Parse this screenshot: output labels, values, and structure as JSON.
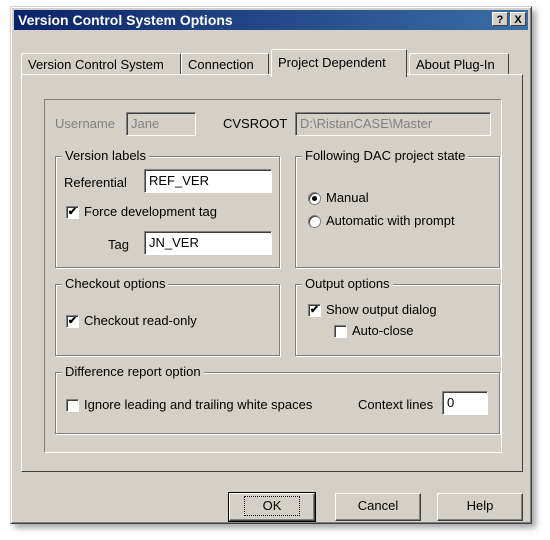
{
  "window": {
    "title": "Version Control System Options",
    "help_glyph": "?",
    "close_glyph": "X"
  },
  "tabs": [
    {
      "label": "Version Control System"
    },
    {
      "label": "Connection"
    },
    {
      "label": "Project Dependent",
      "active": true
    },
    {
      "label": "About Plug-In"
    }
  ],
  "identity": {
    "username_label": "Username",
    "username_value": "Jane",
    "cvsroot_label": "CVSROOT",
    "cvsroot_value": "D:\\RistanCASE\\Master"
  },
  "version_labels": {
    "legend": "Version labels",
    "referential_label": "Referential",
    "referential_value": "REF_VER",
    "force_dev_tag_label": "Force development tag",
    "force_dev_tag_checked": true,
    "tag_label": "Tag",
    "tag_value": "JN_VER"
  },
  "dac_state": {
    "legend": "Following DAC project state",
    "manual_label": "Manual",
    "manual_selected": true,
    "automatic_label": "Automatic with prompt"
  },
  "checkout": {
    "legend": "Checkout options",
    "readonly_label": "Checkout read-only",
    "readonly_checked": true
  },
  "output": {
    "legend": "Output options",
    "show_dialog_label": "Show output dialog",
    "show_dialog_checked": true,
    "auto_close_label": "Auto-close",
    "auto_close_checked": false
  },
  "difference": {
    "legend": "Difference report option",
    "ignore_ws_label": "Ignore leading and trailing white spaces",
    "ignore_ws_checked": false,
    "context_lines_label": "Context lines",
    "context_lines_value": "0"
  },
  "buttons": {
    "ok": "OK",
    "cancel": "Cancel",
    "help": "Help"
  },
  "colors": {
    "face": "#d4d0c8",
    "title_start": "#0a246a",
    "title_end": "#3a6ea5"
  },
  "check_glyph": "✔"
}
